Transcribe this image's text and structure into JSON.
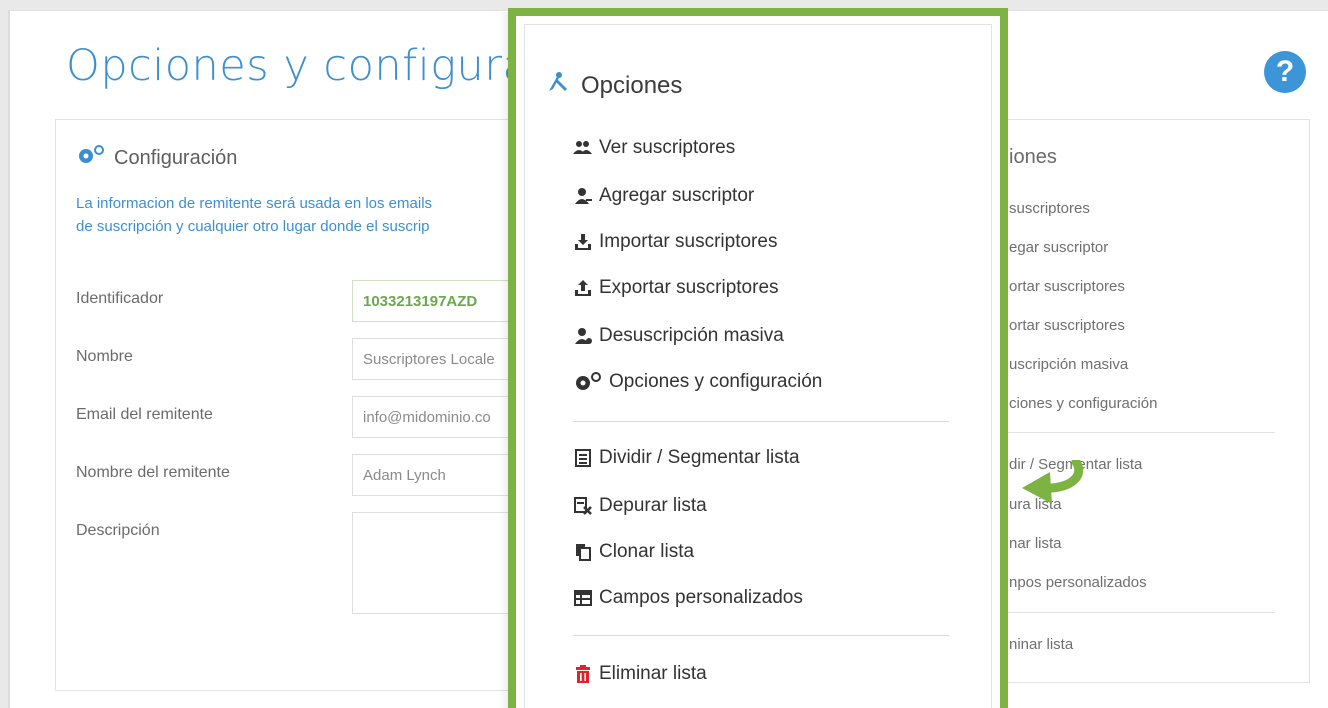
{
  "page": {
    "title": "Opciones y configuración"
  },
  "config": {
    "heading": "Configuración",
    "intro_line1": "La informacion de remitente será usada en los emails",
    "intro_line2": "de suscripción y cualquier otro lugar donde el suscrip",
    "fields": [
      {
        "label": "Identificador",
        "value": "1033213197AZD"
      },
      {
        "label": "Nombre",
        "value": "Suscriptores Locale"
      },
      {
        "label": "Email del remitente",
        "value": "info@midominio.co"
      },
      {
        "label": "Nombre del remitente",
        "value": "Adam Lynch"
      },
      {
        "label": "Descripción",
        "value": ""
      }
    ]
  },
  "background_options": {
    "title": "iones",
    "items": [
      "suscriptores",
      "egar suscriptor",
      "ortar suscriptores",
      "ortar suscriptores",
      "uscripción masiva",
      "ciones y configuración",
      "dir / Segmentar lista",
      "ura lista",
      "nar lista",
      "npos personalizados",
      "ninar lista"
    ]
  },
  "popup": {
    "title": "Opciones",
    "groups": [
      [
        {
          "label": "Ver suscriptores",
          "icon": "users-icon"
        },
        {
          "label": "Agregar suscriptor",
          "icon": "user-add-icon"
        },
        {
          "label": "Importar suscriptores",
          "icon": "import-icon"
        },
        {
          "label": "Exportar suscriptores",
          "icon": "export-icon"
        },
        {
          "label": "Desuscripción masiva",
          "icon": "user-remove-icon"
        },
        {
          "label": "Opciones y configuración",
          "icon": "gears-icon"
        }
      ],
      [
        {
          "label": "Dividir / Segmentar lista",
          "icon": "split-list-icon"
        },
        {
          "label": "Depurar lista",
          "icon": "clean-list-icon"
        },
        {
          "label": "Clonar lista",
          "icon": "clone-icon"
        },
        {
          "label": "Campos personalizados",
          "icon": "table-icon"
        }
      ],
      [
        {
          "label": "Eliminar lista",
          "icon": "trash-icon"
        }
      ]
    ]
  },
  "colors": {
    "accent_blue": "#3f8fcf",
    "highlight_green": "#7cb342",
    "danger_red": "#d9262c",
    "id_green": "#6aa84f"
  }
}
